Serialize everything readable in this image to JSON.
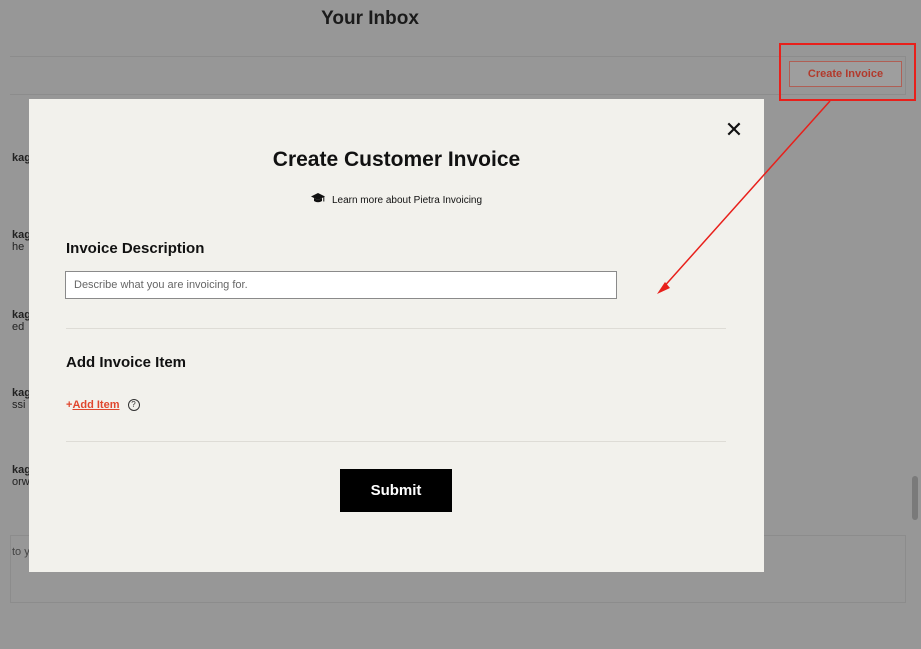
{
  "background": {
    "title": "Your Inbox",
    "create_invoice_label": "Create Invoice",
    "rows": [
      {
        "line1": "kag",
        "line2": ""
      },
      {
        "line1": "kag",
        "line2": "he"
      },
      {
        "line1": "kag",
        "line2": "ed"
      },
      {
        "line1": "kag",
        "line2": "ssi"
      },
      {
        "line1": "kag",
        "line2": "orw"
      }
    ],
    "message_input_text": "to y"
  },
  "modal": {
    "title": "Create Customer Invoice",
    "learn_more": "Learn more about Pietra Invoicing",
    "learn_icon": "graduation-cap-icon",
    "description_label": "Invoice Description",
    "description_placeholder": "Describe what you are invoicing for.",
    "description_value": "",
    "add_item_section_label": "Add Invoice Item",
    "add_item_plus": "+",
    "add_item_label": "Add Item",
    "help_icon": "question-circle-icon",
    "submit_label": "Submit",
    "close_icon": "close-icon"
  },
  "colors": {
    "overlay": "#979797",
    "modal_bg": "#f2f1ec",
    "accent": "#e0462d",
    "annotation": "#e8201b"
  }
}
